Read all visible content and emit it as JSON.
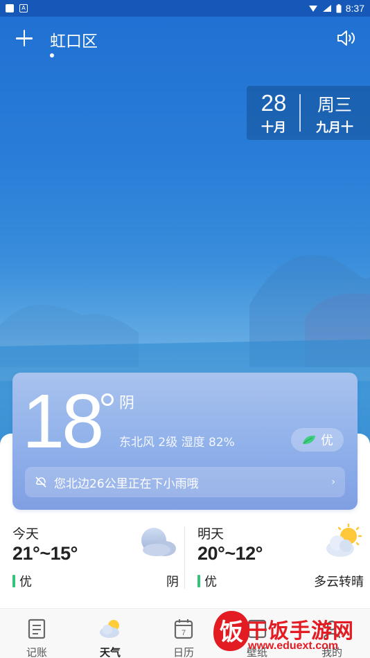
{
  "status_bar": {
    "time": "8:37"
  },
  "header": {
    "city": "虹口区"
  },
  "date": {
    "day": "28",
    "month": "十月",
    "weekday": "周三",
    "lunar": "九月十"
  },
  "current": {
    "temperature": "18",
    "condition": "阴",
    "wind_humidity": "东北风 2级  湿度 82%",
    "aqi": "优",
    "rain_alert": "您北边26公里正在下小雨哦"
  },
  "today": {
    "label": "今天",
    "range": "21°~15°",
    "aqi": "优",
    "condition": "阴",
    "icon": "cloudy-icon"
  },
  "tomorrow": {
    "label": "明天",
    "range": "20°~12°",
    "aqi": "优",
    "condition": "多云转晴",
    "icon": "partly-sunny-icon"
  },
  "nav": [
    {
      "label": "记账",
      "icon": "ledger-icon"
    },
    {
      "label": "天气",
      "icon": "weather-icon"
    },
    {
      "label": "日历",
      "icon": "calendar-icon",
      "badge": "7"
    },
    {
      "label": "壁纸",
      "icon": "wallpaper-icon"
    },
    {
      "label": "我的",
      "icon": "profile-icon"
    }
  ],
  "watermark": {
    "text": "干饭手游网",
    "url": "www.eduext.com",
    "logo_char": "饭"
  },
  "colors": {
    "sky_top": "#1f6fd2",
    "card": "#8fb0ea",
    "aqi_green": "#34c37a",
    "watermark_red": "#e21c22"
  }
}
